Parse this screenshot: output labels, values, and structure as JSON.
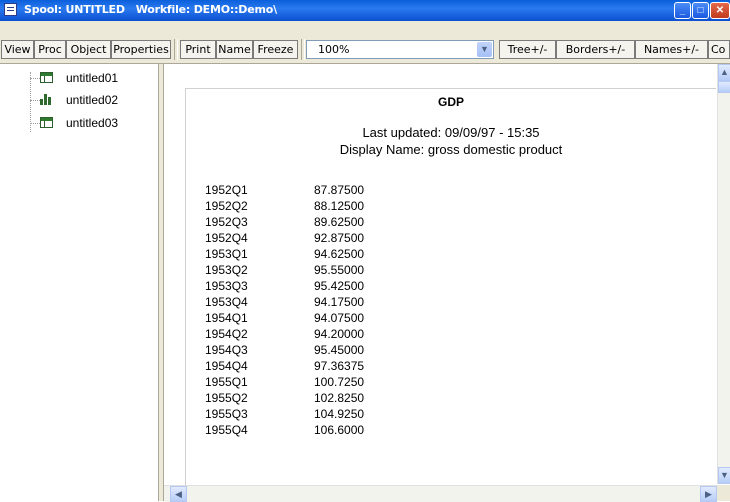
{
  "window": {
    "title": "Spool: UNTITLED   Workfile: DEMO::Demo\\",
    "buttons": {
      "minimize": "_",
      "maximize": "□",
      "close": "✕"
    }
  },
  "toolbar": {
    "buttons": [
      "View",
      "Proc",
      "Object",
      "Properties",
      "Print",
      "Name",
      "Freeze"
    ],
    "zoom": "100%",
    "right_buttons": [
      "Tree+/-",
      "Borders+/-",
      "Names+/-",
      "Co"
    ]
  },
  "tree": {
    "items": [
      {
        "label": "untitled01",
        "icon": "table-icon"
      },
      {
        "label": "untitled02",
        "icon": "graph-icon"
      },
      {
        "label": "untitled03",
        "icon": "table-icon"
      }
    ]
  },
  "document": {
    "title": "GDP",
    "last_updated": "Last updated: 09/09/97 - 15:35",
    "display_name": "Display Name: gross domestic product",
    "rows": [
      {
        "date": "1952Q1",
        "value": "87.87500"
      },
      {
        "date": "1952Q2",
        "value": "88.12500"
      },
      {
        "date": "1952Q3",
        "value": "89.62500"
      },
      {
        "date": "1952Q4",
        "value": "92.87500"
      },
      {
        "date": "1953Q1",
        "value": "94.62500"
      },
      {
        "date": "1953Q2",
        "value": "95.55000"
      },
      {
        "date": "1953Q3",
        "value": "95.42500"
      },
      {
        "date": "1953Q4",
        "value": "94.17500"
      },
      {
        "date": "1954Q1",
        "value": "94.07500"
      },
      {
        "date": "1954Q2",
        "value": "94.20000"
      },
      {
        "date": "1954Q3",
        "value": "95.45000"
      },
      {
        "date": "1954Q4",
        "value": "97.36375"
      },
      {
        "date": "1955Q1",
        "value": "100.7250"
      },
      {
        "date": "1955Q2",
        "value": "102.8250"
      },
      {
        "date": "1955Q3",
        "value": "104.9250"
      },
      {
        "date": "1955Q4",
        "value": "106.6000"
      }
    ]
  },
  "scrollbar": {
    "up": "▲",
    "down": "▼",
    "left": "◀",
    "right": "▶"
  }
}
